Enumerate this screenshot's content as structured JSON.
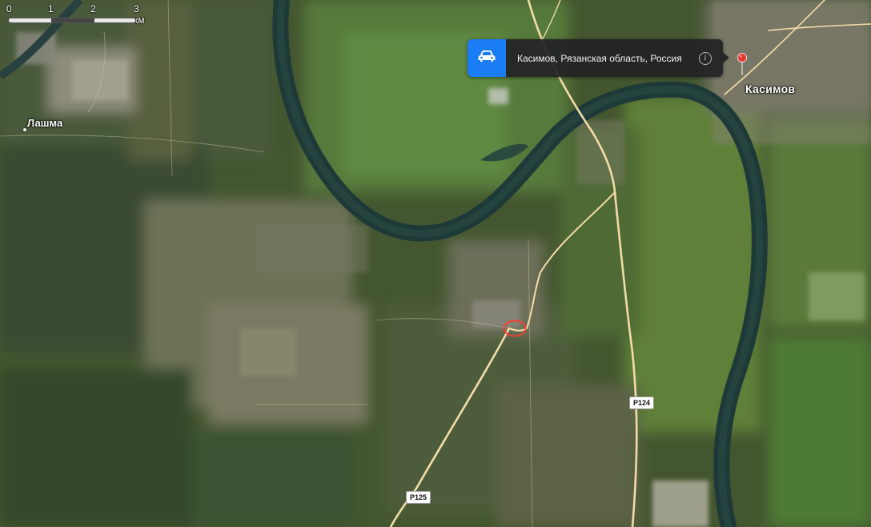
{
  "scale": {
    "labels": [
      "0",
      "1",
      "2",
      "3 км"
    ]
  },
  "places": {
    "lashma": "Лашма",
    "kasimov": "Касимов"
  },
  "callout": {
    "title": "Касимов, Рязанская область, Россия",
    "icon": "car-icon",
    "info_icon": "info-icon",
    "accent_color": "#1b7df4"
  },
  "roads": {
    "r124": "Р124",
    "r125": "Р125"
  },
  "colors": {
    "river": "#1e3a38",
    "road": "#f3dca8",
    "marker": "#ff3b2f",
    "pin": "#e8322c"
  }
}
